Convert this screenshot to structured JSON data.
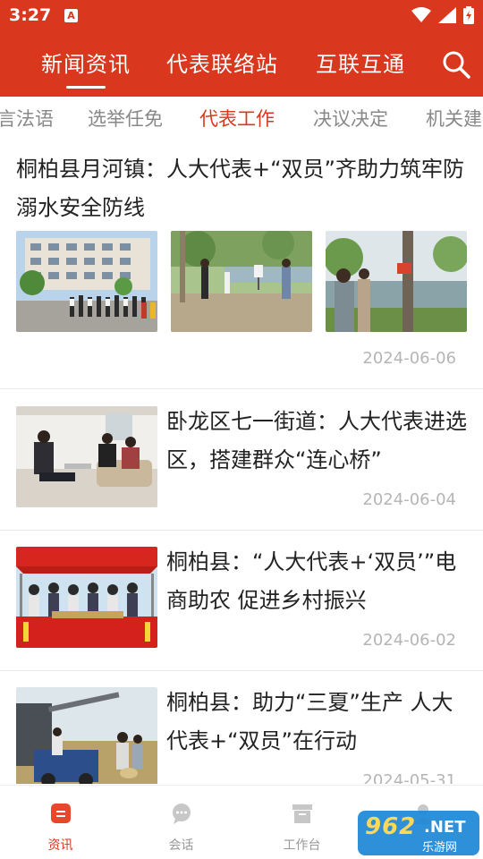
{
  "status_bar": {
    "time": "3:27",
    "notification_glyph": "A"
  },
  "header": {
    "tabs": [
      {
        "label": "新闻资讯",
        "active": true
      },
      {
        "label": "代表联络站",
        "active": false
      },
      {
        "label": "互联互通",
        "active": false
      }
    ]
  },
  "sub_tabs": [
    {
      "label": "言法语",
      "active": false
    },
    {
      "label": "选举任免",
      "active": false
    },
    {
      "label": "代表工作",
      "active": true
    },
    {
      "label": "决议决定",
      "active": false
    },
    {
      "label": "机关建",
      "active": false
    }
  ],
  "articles": [
    {
      "title": "桐柏县月河镇：人大代表+“双员”齐助力筑牢防溺水安全防线",
      "date": "2024-06-06"
    },
    {
      "title": "卧龙区七一街道：人大代表进选区，搭建群众“连心桥”",
      "date": "2024-06-04"
    },
    {
      "title": "桐柏县：“人大代表+‘双员’”电商助农 促进乡村振兴",
      "date": "2024-06-02"
    },
    {
      "title": "桐柏县：助力“三夏”生产 人大代表+“双员”在行动",
      "date": "2024-05-31"
    }
  ],
  "bottom_nav": [
    {
      "label": "资讯",
      "icon": "news-icon",
      "active": true
    },
    {
      "label": "会话",
      "icon": "chat-icon",
      "active": false
    },
    {
      "label": "工作台",
      "icon": "workbench-icon",
      "active": false
    },
    {
      "label": "",
      "icon": "profile-icon",
      "active": false
    }
  ],
  "watermark": {
    "number": "962",
    "suffix": ".NET",
    "text": "乐游网"
  },
  "colors": {
    "brand": "#d9381e",
    "inactive": "#888888",
    "date": "#b5b5b5"
  }
}
